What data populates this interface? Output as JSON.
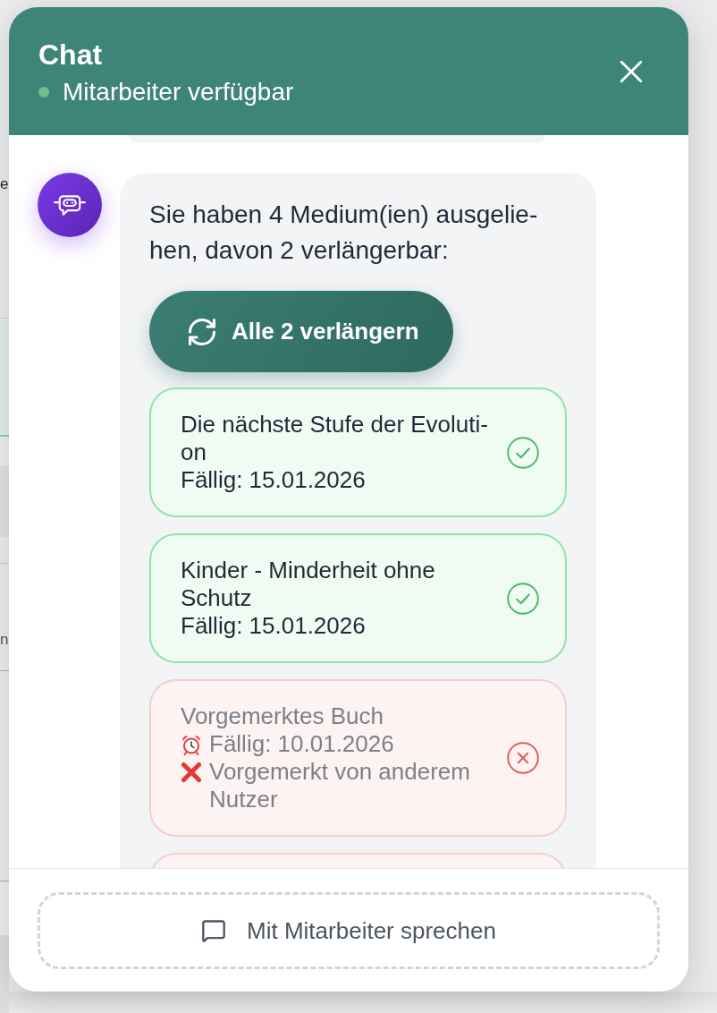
{
  "background_page": {
    "texts": [
      "e",
      "n"
    ]
  },
  "chat": {
    "header": {
      "title": "Chat",
      "status": {
        "label": "Mitarbeiter verfügbar",
        "online": true
      }
    },
    "messages": [
      {
        "kind": "clipped"
      },
      {
        "kind": "bot",
        "text": "Sie haben 4 Medium(ien) ausgelie-hen, davon 2 verlängerbar:",
        "action": {
          "label": "Alle 2 verlängern"
        },
        "items": [
          {
            "renewable": true,
            "lines": [
              {
                "kind": "title",
                "text": "Die nächste Stufe der Evoluti-on"
              },
              {
                "kind": "due",
                "text": "Fällig: 15.01.2026"
              }
            ]
          },
          {
            "renewable": true,
            "lines": [
              {
                "kind": "title",
                "text": "Kinder - Minderheit ohne Schutz"
              },
              {
                "kind": "due",
                "text": "Fällig: 15.01.2026"
              }
            ]
          },
          {
            "renewable": false,
            "lines": [
              {
                "kind": "title",
                "text": "Vorgemerktes Buch"
              },
              {
                "kind": "overdue",
                "text": "Fällig: 10.01.2026"
              },
              {
                "kind": "blocked",
                "text": "Vorgemerkt von anderem Nutzer"
              }
            ]
          },
          {
            "renewable": false
          }
        ]
      }
    ],
    "footer": {
      "button": {
        "label": "Mit Mitarbeiter sprechen"
      }
    }
  }
}
